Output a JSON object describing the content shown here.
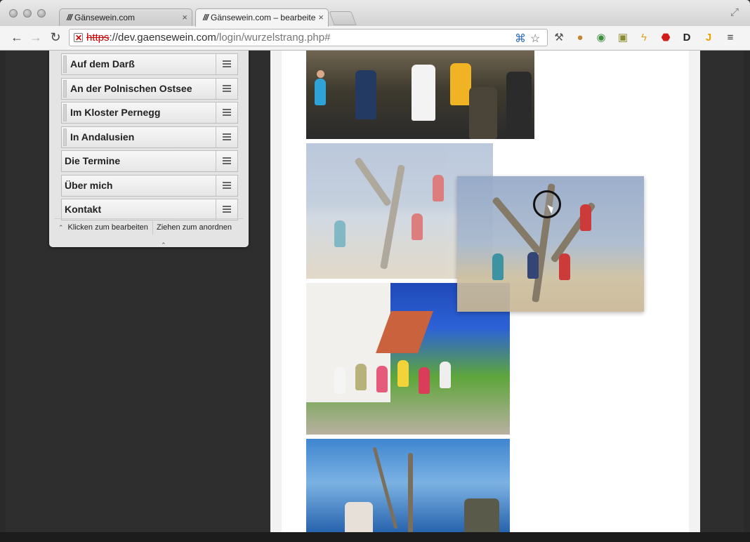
{
  "browser": {
    "tabs": [
      {
        "favicon": "///",
        "title": "Gänsewein.com",
        "active": false
      },
      {
        "favicon": "///",
        "title": "Gänsewein.com – bearbeiten",
        "active": true
      }
    ],
    "close_glyph": "×",
    "url": {
      "scheme": "https",
      "host": "://dev.gaensewein.com",
      "path": "/login/wurzelstrang.php#"
    }
  },
  "nav": {
    "items": [
      {
        "label": "Auf dem Darß",
        "indented": true
      },
      {
        "label": "An der Polnischen Ostsee",
        "indented": true
      },
      {
        "label": "Im Kloster Pernegg",
        "indented": true
      },
      {
        "label": "In Andalusien",
        "indented": true
      },
      {
        "label": "Die Termine",
        "indented": false
      },
      {
        "label": "Über mich",
        "indented": false
      },
      {
        "label": "Kontakt",
        "indented": false
      }
    ],
    "footer": {
      "click_to_edit": "Klicken zum bearbeiten",
      "drag_to_sort": "Ziehen zum anordnen"
    }
  },
  "photos": [
    {
      "subject": "group-in-winter-jackets"
    },
    {
      "subject": "group-on-driftwood-tree-faded"
    },
    {
      "subject": "group-at-monastery-cheering"
    },
    {
      "subject": "men-with-olive-tree-at-sea"
    }
  ],
  "drag_ghost": {
    "subject": "group-on-driftwood-tree"
  },
  "colors": {
    "accent": "#c00000",
    "page_bg": "#2e2e2e",
    "panel_bg": "#e4e4e4"
  }
}
